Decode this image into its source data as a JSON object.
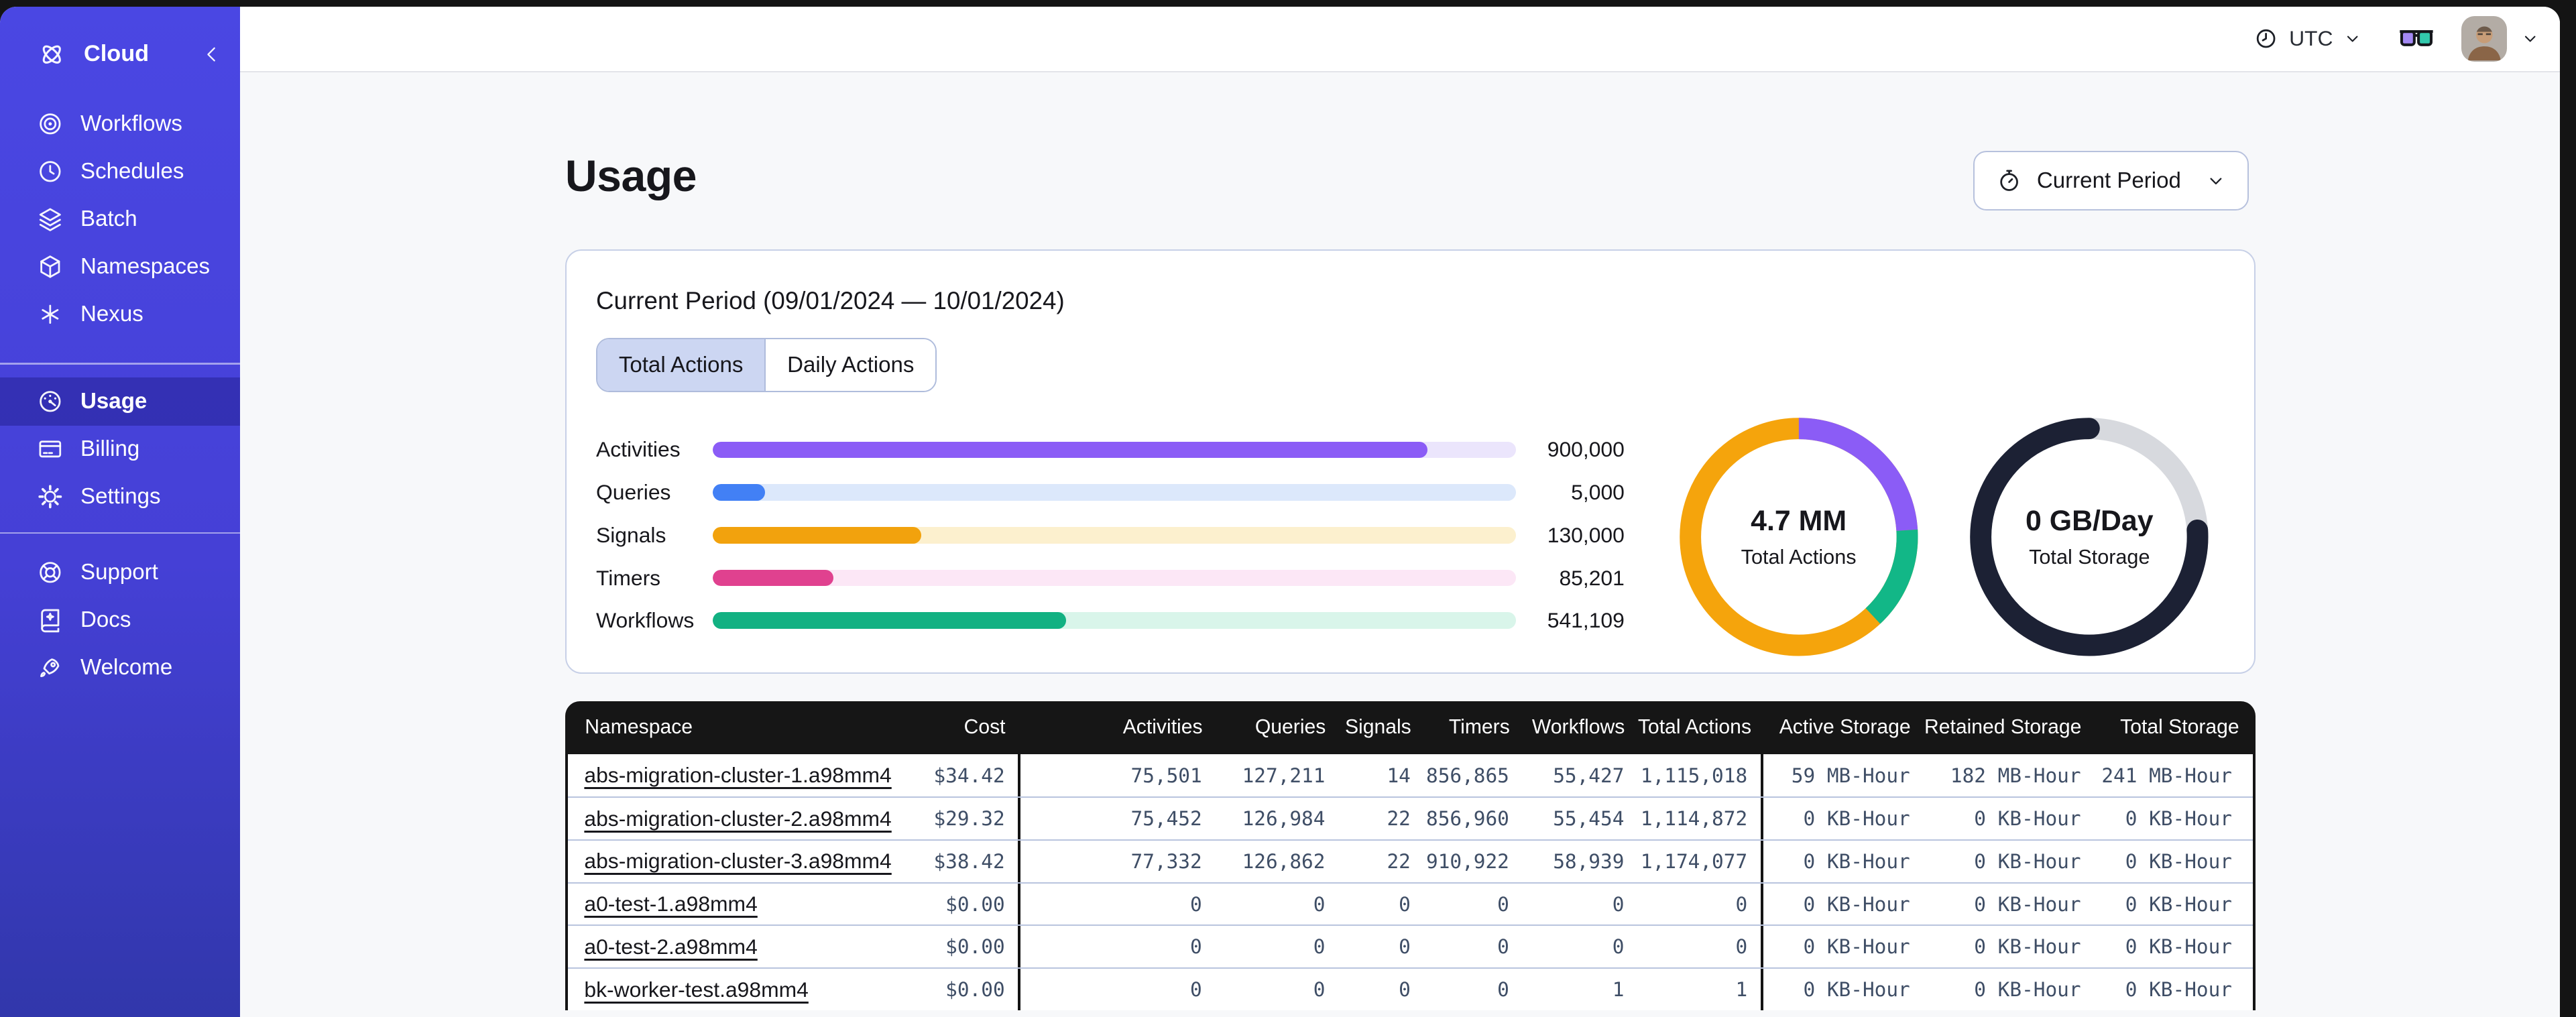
{
  "theme": {
    "sidebar_bg_top": "#4A47E3",
    "sidebar_bg_bottom": "#3137AB",
    "sidebar_active_bg": "rgba(9,8,92,0.30)",
    "content_bg": "#F7F8FA",
    "card_border": "#C7D0E7",
    "tab_active_bg": "#CCD6F2",
    "table_header_bg": "#161616",
    "table_frame": "#141414",
    "table_row_divider": "#B9C4DE",
    "number_color": "#3F4E66",
    "text_color": "#17171C"
  },
  "sidebar": {
    "brand": "Cloud",
    "groups": [
      {
        "items": [
          {
            "label": "Workflows"
          },
          {
            "label": "Schedules"
          },
          {
            "label": "Batch"
          },
          {
            "label": "Namespaces"
          },
          {
            "label": "Nexus"
          }
        ]
      },
      {
        "items": [
          {
            "label": "Usage",
            "active": true
          },
          {
            "label": "Billing"
          },
          {
            "label": "Settings"
          }
        ]
      },
      {
        "items": [
          {
            "label": "Support"
          },
          {
            "label": "Docs"
          },
          {
            "label": "Welcome"
          }
        ]
      }
    ]
  },
  "topbar": {
    "timezone": "UTC"
  },
  "page": {
    "title": "Usage",
    "period_button": "Current Period"
  },
  "card": {
    "title": "Current Period (09/01/2024 — 10/01/2024)",
    "tabs": [
      {
        "label": "Total Actions",
        "active": true
      },
      {
        "label": "Daily Actions",
        "active": false
      }
    ]
  },
  "chart_data": [
    {
      "type": "bar",
      "orientation": "horizontal",
      "title": "Total Actions by type",
      "categories": [
        "Activities",
        "Queries",
        "Signals",
        "Timers",
        "Workflows"
      ],
      "values": [
        900000,
        5000,
        130000,
        85201,
        541109
      ],
      "display_values": [
        "900,000",
        "5,000",
        "130,000",
        "85,201",
        "541,109"
      ],
      "fill_percent": [
        89,
        6.5,
        26,
        15,
        44
      ],
      "bar_colors": [
        "#8B5CF6",
        "#4280F5",
        "#F2A20D",
        "#E0418F",
        "#12B182"
      ],
      "track_colors": [
        "#EBE5FC",
        "#DCE8FB",
        "#FCF0CE",
        "#FCE7F6",
        "#D9F5EA"
      ],
      "grid": false,
      "legend": false
    },
    {
      "type": "donut",
      "center_value": "4.7 MM",
      "center_label": "Total Actions",
      "ring": {
        "base_color": "#F5A40C",
        "arcs": [
          {
            "color": "#8B5CF6",
            "start_pct": 0,
            "end_pct": 24
          },
          {
            "color": "#12B787",
            "start_pct": 24,
            "end_pct": 38
          }
        ]
      }
    },
    {
      "type": "donut",
      "center_value": "0 GB/Day",
      "center_label": "Total Storage",
      "ring": {
        "base_color": "#D7D9DE",
        "arcs": [
          {
            "color": "#1C2134",
            "start_pct": 24,
            "end_pct": 100,
            "linecap": "round"
          }
        ]
      }
    }
  ],
  "table": {
    "columns": [
      {
        "label": "Namespace",
        "align": "left"
      },
      {
        "label": "Cost",
        "align": "right"
      },
      {
        "label": "Activities",
        "align": "right",
        "group_start": true
      },
      {
        "label": "Queries",
        "align": "right"
      },
      {
        "label": "Signals",
        "align": "right"
      },
      {
        "label": "Timers",
        "align": "right"
      },
      {
        "label": "Workflows",
        "align": "right"
      },
      {
        "label": "Total Actions",
        "align": "right"
      },
      {
        "label": "Active Storage",
        "align": "right",
        "group_start": true
      },
      {
        "label": "Retained Storage",
        "align": "right"
      },
      {
        "label": "Total Storage",
        "align": "right"
      }
    ],
    "rows": [
      [
        "abs-migration-cluster-1.a98mm4",
        "$34.42",
        "75,501",
        "127,211",
        "14",
        "856,865",
        "55,427",
        "1,115,018",
        "59 MB-Hour",
        "182 MB-Hour",
        "241 MB-Hour"
      ],
      [
        "abs-migration-cluster-2.a98mm4",
        "$29.32",
        "75,452",
        "126,984",
        "22",
        "856,960",
        "55,454",
        "1,114,872",
        "0 KB-Hour",
        "0 KB-Hour",
        "0 KB-Hour"
      ],
      [
        "abs-migration-cluster-3.a98mm4",
        "$38.42",
        "77,332",
        "126,862",
        "22",
        "910,922",
        "58,939",
        "1,174,077",
        "0 KB-Hour",
        "0 KB-Hour",
        "0 KB-Hour"
      ],
      [
        "a0-test-1.a98mm4",
        "$0.00",
        "0",
        "0",
        "0",
        "0",
        "0",
        "0",
        "0 KB-Hour",
        "0 KB-Hour",
        "0 KB-Hour"
      ],
      [
        "a0-test-2.a98mm4",
        "$0.00",
        "0",
        "0",
        "0",
        "0",
        "0",
        "0",
        "0 KB-Hour",
        "0 KB-Hour",
        "0 KB-Hour"
      ],
      [
        "bk-worker-test.a98mm4",
        "$0.00",
        "0",
        "0",
        "0",
        "0",
        "1",
        "1",
        "0 KB-Hour",
        "0 KB-Hour",
        "0 KB-Hour"
      ]
    ]
  }
}
